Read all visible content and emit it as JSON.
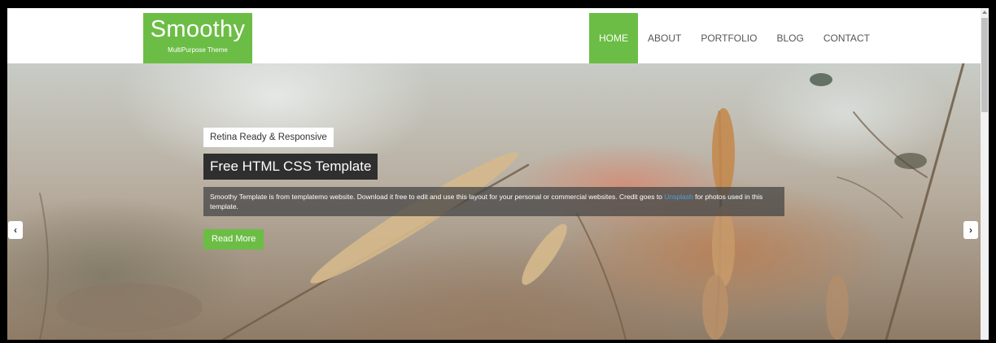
{
  "brand": {
    "title": "Smoothy",
    "subtitle": "MultiPurpose Theme",
    "color": "#6cbd45"
  },
  "nav": {
    "items": [
      {
        "label": "HOME",
        "active": true
      },
      {
        "label": "ABOUT",
        "active": false
      },
      {
        "label": "PORTFOLIO",
        "active": false
      },
      {
        "label": "BLOG",
        "active": false
      },
      {
        "label": "CONTACT",
        "active": false
      }
    ]
  },
  "hero": {
    "badge": "Retina Ready & Responsive",
    "headline": "Free HTML CSS Template",
    "description_before": "Smoothy Template is from templatemo website. Download it free to edit and use this layout for your personal or commercial websites. Credit goes to",
    "description_link": "Unsplash",
    "description_after": "for photos used in this template.",
    "button": "Read More",
    "prev_icon": "chevron-left-icon",
    "next_icon": "chevron-right-icon"
  },
  "scrollbar": {
    "up_icon": "scroll-up-arrow-icon"
  }
}
